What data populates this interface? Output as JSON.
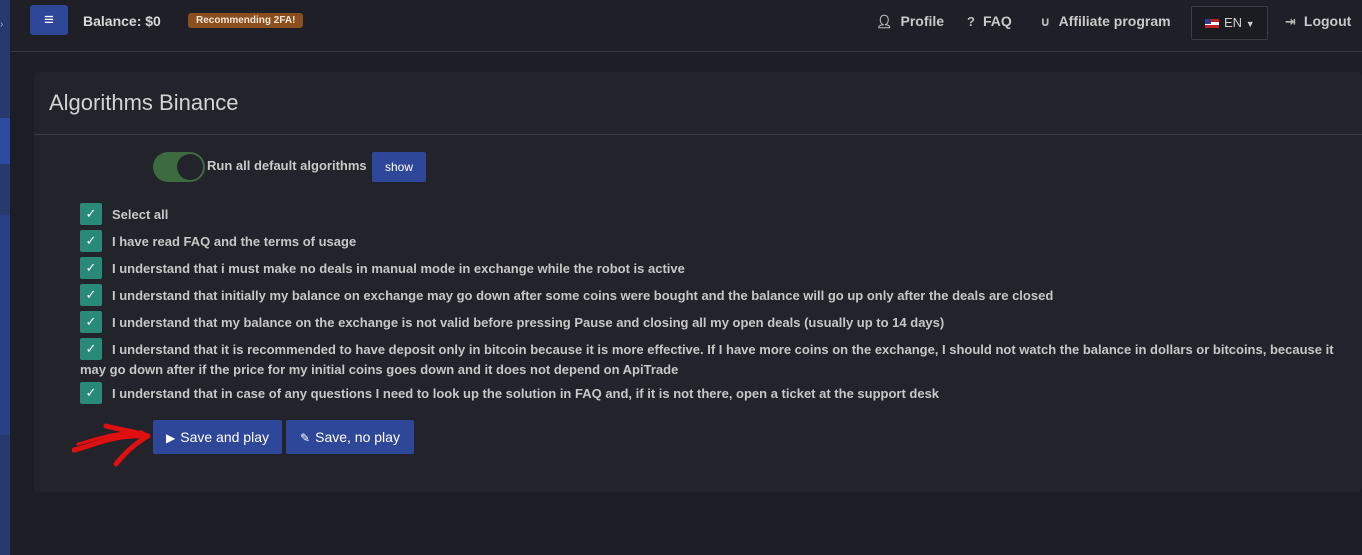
{
  "topbar": {
    "menu_icon": "hamburger-icon",
    "balance": "Balance: $0",
    "badge": "Recommending 2FA!",
    "nav": [
      {
        "icon": "user-icon",
        "label": "Profile"
      },
      {
        "icon": "question-icon",
        "label": "FAQ"
      },
      {
        "icon": "magnet-icon",
        "label": "Affiliate program"
      }
    ],
    "language": "EN",
    "logout": "Logout"
  },
  "panel": {
    "title": "Algorithms Binance",
    "toggle_label": "Run all default algorithms",
    "show_label": "show",
    "checkboxes": [
      "Select all",
      "I have read FAQ and the terms of usage",
      "I understand that i must make no deals in manual mode in exchange while the robot is active",
      "I understand that initially my balance on exchange may go down after some coins were bought and the balance will go up only after the deals are closed",
      "I understand that my balance on the exchange is not valid before pressing Pause and closing all my open deals (usually up to 14 days)",
      "I understand that it is recommended to have deposit only in bitcoin because it is more effective. If I have more coins on the exchange, I should not watch the balance in dollars or bitcoins, because it may go down after if the price for my initial coins goes down and it does not depend on ApiTrade",
      "I understand that in case of any questions I need to look up the solution in FAQ and, if it is not there, open a ticket at the support desk"
    ],
    "save_play": "Save and play",
    "save_no_play": "Save, no play"
  },
  "colors": {
    "accent": "#2f4799",
    "checkbox": "#2a8a7a",
    "badge": "#8a4f1f",
    "toggle_on": "#3c6b3f",
    "annotation": "#e01010"
  }
}
